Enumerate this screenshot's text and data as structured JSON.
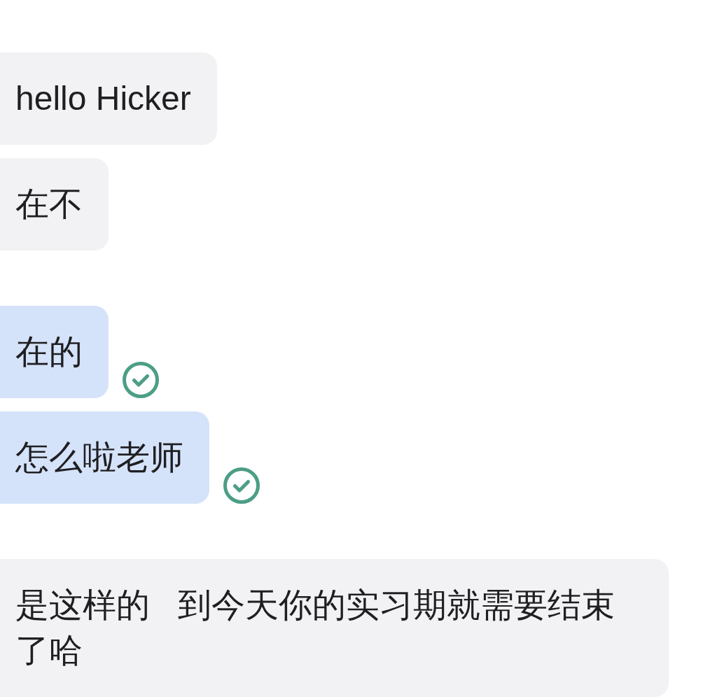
{
  "messages": [
    {
      "kind": "received",
      "text": "hello Hicker"
    },
    {
      "kind": "received",
      "text": "在不"
    },
    {
      "kind": "sent",
      "text": "在的",
      "read": true
    },
    {
      "kind": "sent",
      "text": "怎么啦老师",
      "read": true
    },
    {
      "kind": "received",
      "text": "是这样的   到今天你的实习期就需要结束了哈"
    }
  ]
}
